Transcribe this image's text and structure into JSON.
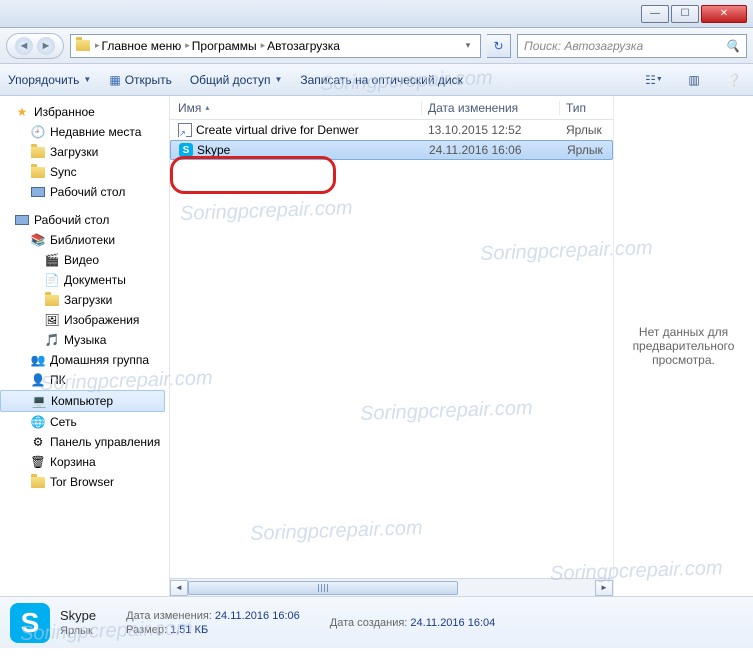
{
  "breadcrumb": {
    "icon": "folder",
    "items": [
      "Главное меню",
      "Программы",
      "Автозагрузка"
    ]
  },
  "search": {
    "placeholder": "Поиск: Автозагрузка"
  },
  "toolbar": {
    "organize": "Упорядочить",
    "open": "Открыть",
    "share": "Общий доступ",
    "burn": "Записать на оптический диск"
  },
  "navpane": {
    "favorites": {
      "label": "Избранное",
      "items": [
        "Недавние места",
        "Загрузки",
        "Sync",
        "Рабочий стол"
      ]
    },
    "desktop": {
      "label": "Рабочий стол",
      "libraries": {
        "label": "Библиотеки",
        "items": [
          "Видео",
          "Документы",
          "Загрузки",
          "Изображения",
          "Музыка"
        ]
      },
      "items": [
        "Домашняя группа",
        "ПК",
        "Компьютер",
        "Сеть",
        "Панель управления",
        "Корзина",
        "Tor Browser"
      ],
      "selected": "Компьютер"
    }
  },
  "columns": {
    "name": "Имя",
    "date": "Дата изменения",
    "type": "Тип"
  },
  "files": [
    {
      "name": "Create virtual drive for Denwer",
      "date": "13.10.2015 12:52",
      "type": "Ярлык",
      "icon": "shortcut",
      "selected": false
    },
    {
      "name": "Skype",
      "date": "24.11.2016 16:06",
      "type": "Ярлык",
      "icon": "skype",
      "selected": true
    }
  ],
  "preview": {
    "empty_text": "Нет данных для предварительного просмотра."
  },
  "details": {
    "name": "Skype",
    "type": "Ярлык",
    "modified_label": "Дата изменения:",
    "modified": "24.11.2016 16:06",
    "size_label": "Размер:",
    "size": "1,51 КБ",
    "created_label": "Дата создания:",
    "created": "24.11.2016 16:04"
  },
  "watermark": "Soringpcrepair.com"
}
